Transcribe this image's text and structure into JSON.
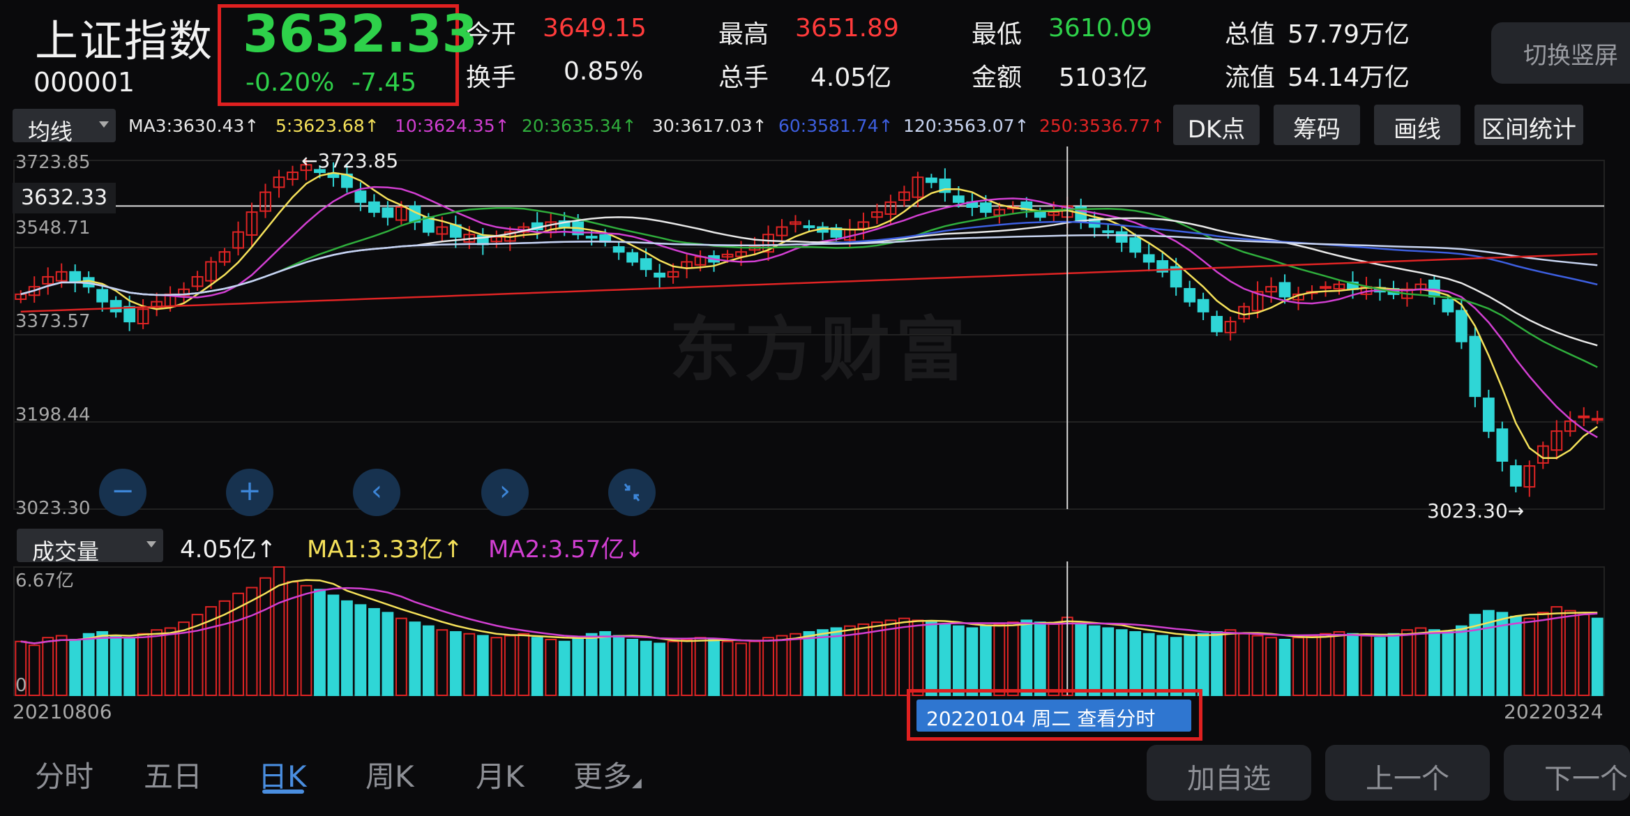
{
  "header": {
    "index_name": "上证指数",
    "index_code": "000001",
    "price": "3632.33",
    "change_pct": "-0.20%",
    "change_abs": "-7.45",
    "stats": {
      "open_label": "今开",
      "open_value": "3649.15",
      "high_label": "最高",
      "high_value": "3651.89",
      "low_label": "最低",
      "low_value": "3610.09",
      "total_cap_label": "总值",
      "total_cap_value": "57.79万亿",
      "turnover_label": "换手",
      "turnover_value": "0.85%",
      "volume_label": "总手",
      "volume_value": "4.05亿",
      "amount_label": "金额",
      "amount_value": "5103亿",
      "float_cap_label": "流值",
      "float_cap_value": "54.14万亿"
    },
    "switch_button": "切换竖屏"
  },
  "ma_bar": {
    "dropdown": "均线",
    "items": [
      {
        "text": "MA3:3630.43↑",
        "color": "#e8e8e8"
      },
      {
        "text": "5:3623.68↑",
        "color": "#f5e15a"
      },
      {
        "text": "10:3624.35↑",
        "color": "#d23fd2"
      },
      {
        "text": "20:3635.34↑",
        "color": "#2fae3c"
      },
      {
        "text": "30:3617.03↑",
        "color": "#e8e8e8"
      },
      {
        "text": "60:3581.74↑",
        "color": "#3d5fe0"
      },
      {
        "text": "120:3563.07↑",
        "color": "#c8d4f0"
      },
      {
        "text": "250:3536.77↑",
        "color": "#e02424"
      }
    ],
    "buttons": {
      "dk": "DK点",
      "chips": "筹码",
      "draw": "画线",
      "range": "区间统计"
    }
  },
  "chart_data": {
    "type": "candlestick",
    "y_axis_labels": [
      "3723.85",
      "3548.71",
      "3373.57",
      "3198.44",
      "3023.30"
    ],
    "current_price_label": "3632.33",
    "high_marker": "←3723.85",
    "low_marker": "3023.30→",
    "ylim": [
      3023.3,
      3723.85
    ],
    "x_start": "20210806",
    "x_end": "20220324",
    "closes": [
      3455,
      3470,
      3490,
      3500,
      3480,
      3470,
      3440,
      3420,
      3400,
      3425,
      3440,
      3455,
      3465,
      3490,
      3520,
      3540,
      3580,
      3620,
      3660,
      3690,
      3700,
      3715,
      3700,
      3690,
      3670,
      3640,
      3620,
      3610,
      3630,
      3600,
      3580,
      3590,
      3570,
      3575,
      3555,
      3570,
      3580,
      3590,
      3585,
      3600,
      3590,
      3575,
      3570,
      3560,
      3540,
      3520,
      3505,
      3490,
      3500,
      3520,
      3530,
      3520,
      3535,
      3540,
      3550,
      3575,
      3590,
      3600,
      3590,
      3580,
      3570,
      3585,
      3600,
      3620,
      3640,
      3660,
      3690,
      3680,
      3660,
      3640,
      3630,
      3620,
      3625,
      3630,
      3625,
      3610,
      3620,
      3632,
      3600,
      3590,
      3580,
      3560,
      3540,
      3520,
      3500,
      3470,
      3440,
      3420,
      3380,
      3400,
      3430,
      3460,
      3470,
      3450,
      3455,
      3460,
      3470,
      3475,
      3465,
      3470,
      3460,
      3455,
      3465,
      3475,
      3450,
      3420,
      3360,
      3250,
      3180,
      3120,
      3070,
      3110,
      3150,
      3180,
      3200,
      3210,
      3205
    ],
    "closes_note": null,
    "ma_last_values": {
      "MA5": 3623.68,
      "MA10": 3624.35,
      "MA20": 3635.34,
      "MA30": 3617.03,
      "MA60": 3581.74,
      "MA120": 3563.07,
      "MA250": 3536.77
    },
    "volume": {
      "dropdown": "成交量",
      "current": "4.05亿↑",
      "ma1": "MA1:3.33亿↑",
      "ma2": "MA2:3.57亿↓",
      "y_top_label": "6.67亿",
      "y_bottom_label": "0",
      "values": [
        2.8,
        2.6,
        3.0,
        3.1,
        2.9,
        3.2,
        3.3,
        3.1,
        3.0,
        3.2,
        3.4,
        3.5,
        3.8,
        4.2,
        4.6,
        4.9,
        5.3,
        5.6,
        6.1,
        6.67,
        5.9,
        5.7,
        5.5,
        5.2,
        4.9,
        4.7,
        4.5,
        4.3,
        4.0,
        3.8,
        3.6,
        3.4,
        3.3,
        3.2,
        3.1,
        3.0,
        3.1,
        3.2,
        3.0,
        2.9,
        2.8,
        3.0,
        3.2,
        3.3,
        3.1,
        2.9,
        2.8,
        2.7,
        2.8,
        2.9,
        3.0,
        2.9,
        2.8,
        2.7,
        2.8,
        3.0,
        3.1,
        3.2,
        3.3,
        3.4,
        3.5,
        3.6,
        3.7,
        3.8,
        3.9,
        4.0,
        3.9,
        3.8,
        3.7,
        3.6,
        3.5,
        3.6,
        3.7,
        3.8,
        3.9,
        3.8,
        3.7,
        4.05,
        3.7,
        3.6,
        3.5,
        3.4,
        3.3,
        3.2,
        3.1,
        3.0,
        3.1,
        3.2,
        3.3,
        3.4,
        3.2,
        3.1,
        3.0,
        2.9,
        3.0,
        3.1,
        3.2,
        3.3,
        3.2,
        3.1,
        3.0,
        3.2,
        3.4,
        3.5,
        3.4,
        3.3,
        3.6,
        4.2,
        4.4,
        4.3,
        4.1,
        4.0,
        4.3,
        4.6,
        4.4,
        4.2,
        4.0
      ],
      "ylim": [
        0,
        6.67
      ]
    },
    "colors": {
      "up": "#e02424",
      "down": "#2fd6d6",
      "ma_white": "#e8e8e8",
      "ma5": "#f5e15a",
      "ma10": "#d23fd2",
      "ma20": "#2fae3c",
      "ma60": "#3d5fe0",
      "ma120": "#c8d4f0",
      "ma250": "#e02424"
    }
  },
  "date_button": "20220104 周二 查看分时",
  "watermark": "东方财富",
  "bottom_tabs": [
    "分时",
    "五日",
    "日K",
    "周K",
    "月K",
    "更多"
  ],
  "active_tab": "日K",
  "bottom_buttons": {
    "add": "加自选",
    "prev": "上一个",
    "next": "下一个"
  }
}
